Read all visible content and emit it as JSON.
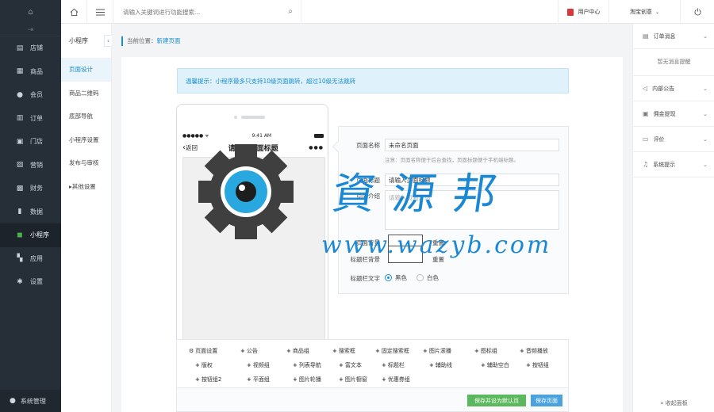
{
  "nav": {
    "items": [
      {
        "label": "店铺",
        "icon": "store-icon"
      },
      {
        "label": "商品",
        "icon": "goods-icon"
      },
      {
        "label": "会员",
        "icon": "member-icon"
      },
      {
        "label": "订单",
        "icon": "order-icon"
      },
      {
        "label": "门店",
        "icon": "shop-icon"
      },
      {
        "label": "营销",
        "icon": "marketing-icon"
      },
      {
        "label": "财务",
        "icon": "finance-icon"
      },
      {
        "label": "数据",
        "icon": "data-icon"
      },
      {
        "label": "小程序",
        "icon": "miniprogram-icon",
        "active": true
      },
      {
        "label": "应用",
        "icon": "apps-icon"
      },
      {
        "label": "设置",
        "icon": "settings-icon"
      }
    ],
    "system_label": "系统管理"
  },
  "topbar": {
    "search_placeholder": "请输入关键词进行功能搜索...",
    "user_center": "用户中心",
    "store_name": "淘宝创意"
  },
  "subnav": {
    "title": "小程序",
    "items": [
      "页面设计",
      "商品二维码",
      "底部导航",
      "小程序设置",
      "发布与审核",
      "其他设置"
    ]
  },
  "breadcrumb": {
    "prefix": "当前位置：",
    "current": "新建页面"
  },
  "tip": "温馨提示：小程序最多只支持10级页面跳转，超过10级无法跳转",
  "phone": {
    "signal": "●●●●● ᯤ",
    "time": "9:41 AM",
    "back": "返回",
    "title": "请输入页面标题",
    "more": "●●●"
  },
  "form": {
    "name_label": "页面名称",
    "name_value": "未命名页面",
    "name_note": "注意：页面名称便于后台查找，页面标题便于手机端标题。",
    "title_label": "页面标题",
    "title_value": "请输入页面标题",
    "intro_label": "页面介绍",
    "intro_placeholder": "请输入页面介绍",
    "bg_label": "页面背景",
    "bg_reset": "重置",
    "titlebg_label": "标题栏背景",
    "titlebg_reset": "重置",
    "textcolor_label": "标题栏文字",
    "opt_black": "黑色",
    "opt_white": "白色"
  },
  "components": [
    [
      "页面设置",
      "公告",
      "商品组",
      "搜索框",
      "固定搜索框",
      "图片滚播",
      "图标组",
      "音频播放"
    ],
    [
      "版权",
      "视频组",
      "列表导航",
      "富文本",
      "标题栏",
      "辅助线",
      "辅助空白",
      "按钮组"
    ],
    [
      "按钮组2",
      "平面组",
      "图片轮播",
      "图片橱窗",
      "优惠券组"
    ]
  ],
  "actions": {
    "save_default": "保存并设为默认页",
    "save": "保存页面"
  },
  "right": {
    "order_msg": "订单消息",
    "no_msg": "暂无消息提醒",
    "notice": "内部公告",
    "commission": "佣金提现",
    "review": "评价",
    "system": "系统提示",
    "collapse": "收起面板"
  },
  "watermark": {
    "chars": "資源邦",
    "url": "www.wazyb.com"
  },
  "colors": {
    "accent": "#1a8fd0",
    "nav_bg": "#262e38",
    "green": "#5cb85c",
    "blue": "#4aa3df"
  }
}
